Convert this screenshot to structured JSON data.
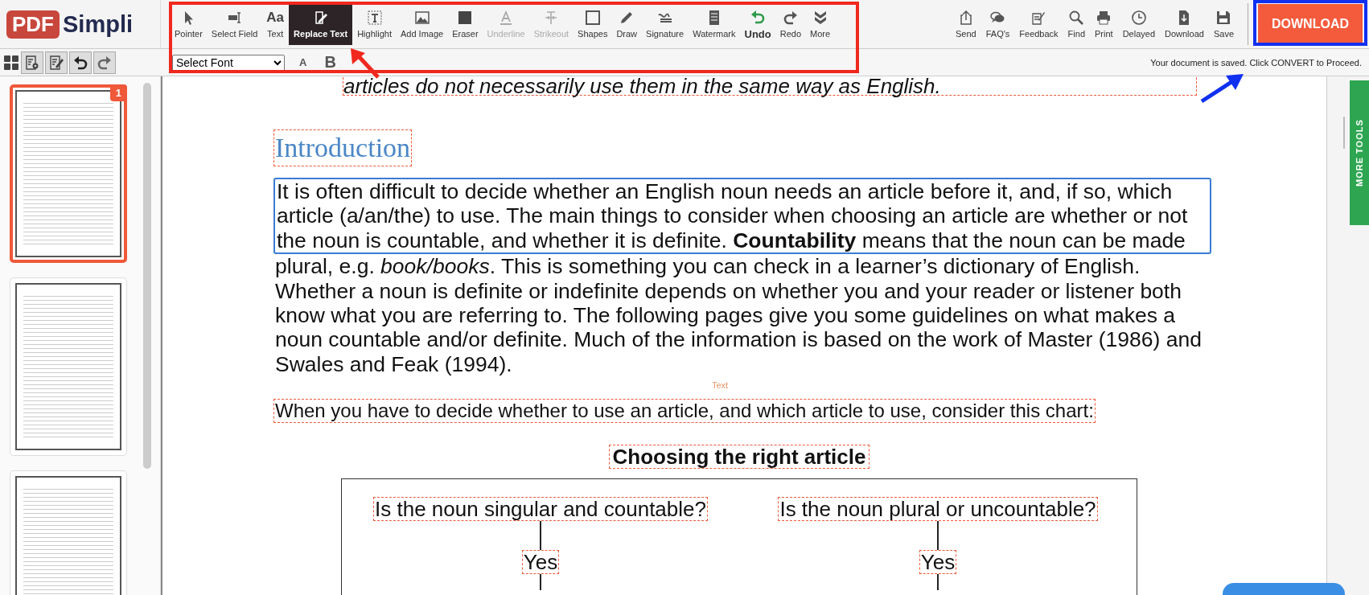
{
  "logo": {
    "badge": "PDF",
    "name": "Simpli"
  },
  "tools": [
    {
      "label": "Pointer",
      "selected": false,
      "disabled": false
    },
    {
      "label": "Select Field",
      "selected": false,
      "disabled": false
    },
    {
      "label": "Text",
      "glyph": "Aa",
      "selected": false,
      "disabled": false
    },
    {
      "label": "Replace Text",
      "selected": true,
      "disabled": false
    },
    {
      "label": "Highlight",
      "selected": false,
      "disabled": false
    },
    {
      "label": "Add Image",
      "selected": false,
      "disabled": false
    },
    {
      "label": "Eraser",
      "selected": false,
      "disabled": false
    },
    {
      "label": "Underline",
      "selected": false,
      "disabled": true
    },
    {
      "label": "Strikeout",
      "selected": false,
      "disabled": true
    },
    {
      "label": "Shapes",
      "selected": false,
      "disabled": false
    },
    {
      "label": "Draw",
      "selected": false,
      "disabled": false
    },
    {
      "label": "Signature",
      "selected": false,
      "disabled": false
    },
    {
      "label": "Watermark",
      "selected": false,
      "disabled": false
    },
    {
      "label": "Undo",
      "selected": false,
      "disabled": false
    },
    {
      "label": "Redo",
      "selected": false,
      "disabled": false
    },
    {
      "label": "More",
      "selected": false,
      "disabled": false
    }
  ],
  "actions": [
    "Send",
    "FAQ's",
    "Feedback",
    "Find",
    "Print",
    "Delayed",
    "Download",
    "Save"
  ],
  "download_button": "DOWNLOAD",
  "font_select": {
    "value": "Select Font"
  },
  "format_buttons": [
    "A",
    "B"
  ],
  "status": "Your document is saved. Click CONVERT to Proceed.",
  "pages": [
    {
      "badge": "1",
      "selected": true
    },
    {
      "selected": false
    },
    {
      "selected": false
    }
  ],
  "more_tools": "MORE TOOLS",
  "document": {
    "top_line": "articles do not necessarily use them in the same way as English.",
    "heading": "Introduction",
    "blocks": [
      {
        "text": "It is often difficult to decide whether an English noun needs an article before it, and, if so, which article (a/an/the) to use. The main things to consider when choosing an article are whether or not the noun is countable, and whether it is definite. **Countability** means that the noun can be made",
        "selected": true
      },
      {
        "text": "plural, e.g. *book/books*. This is something you can check in a learner’s dictionary of English.",
        "selected": false
      },
      {
        "text": "Whether a noun is definite or indefinite depends on whether you and your reader or listener both know what you are referring to. The following pages give you some guidelines on what makes a noun countable and/or definite. Much of the information is based on the work of Master (1986) and Swales and Feak (1994).",
        "selected": false
      }
    ],
    "hover_label": "Text",
    "chart_intro": "When you have to decide whether to use an article, and which article to use, consider this chart:",
    "chart_title": "Choosing the right article",
    "questions": [
      {
        "question": "Is the noun singular and countable?",
        "answer": "Yes"
      },
      {
        "question": "Is the noun plural or uncountable?",
        "answer": "Yes"
      }
    ]
  }
}
